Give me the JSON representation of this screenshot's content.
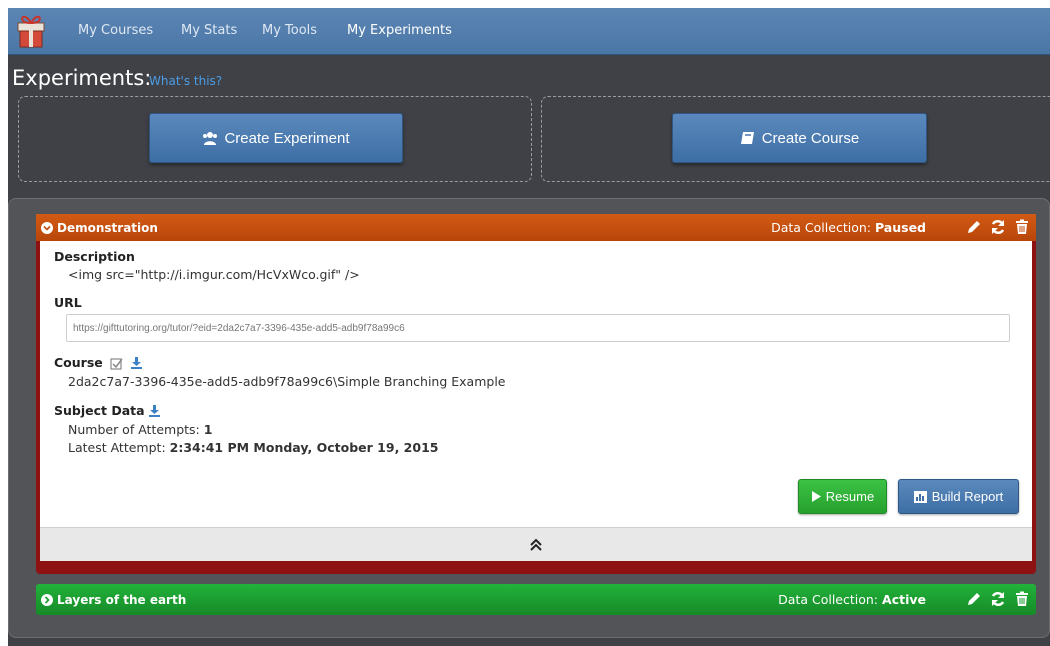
{
  "nav": {
    "items": [
      {
        "label": "My Courses"
      },
      {
        "label": "My Stats"
      },
      {
        "label": "My Tools"
      },
      {
        "label": "My Experiments"
      }
    ]
  },
  "page": {
    "title": "Experiments:",
    "help_link": "What's this?"
  },
  "actions": {
    "create_experiment": "Create Experiment",
    "create_course": "Create Course"
  },
  "experiments": [
    {
      "title": "Demonstration",
      "status_label": "Data Collection:",
      "status_value": "Paused",
      "header_color": "#c34d0c",
      "description_label": "Description",
      "description": "<img src=\"http://i.imgur.com/HcVxWco.gif\" />",
      "url_label": "URL",
      "url": "https://gifttutoring.org/tutor/?eid=2da2c7a7-3396-435e-add5-adb9f78a99c6",
      "course_label": "Course",
      "course": "2da2c7a7-3396-435e-add5-adb9f78a99c6\\Simple Branching Example",
      "subject_label": "Subject Data",
      "attempts_label": "Number of Attempts:",
      "attempts": "1",
      "latest_label": "Latest Attempt:",
      "latest": "2:34:41 PM Monday, October 19, 2015",
      "resume_label": "Resume",
      "report_label": "Build Report"
    },
    {
      "title": "Layers of the earth",
      "status_label": "Data Collection:",
      "status_value": "Active",
      "header_color": "#1a9a2e"
    }
  ],
  "colors": {
    "navbar": "#4f7aab",
    "background": "#3f4146",
    "paused": "#c34d0c",
    "active": "#1a9a2e",
    "resume_button": "#2fab37",
    "report_button": "#3d6ea4"
  },
  "icons": [
    "gift-icon",
    "users-icon",
    "book-icon",
    "chevron-circle-down-icon",
    "chevron-circle-right-icon",
    "pencil-icon",
    "refresh-icon",
    "trash-icon",
    "check-square-icon",
    "download-icon",
    "play-icon",
    "bar-chart-icon",
    "double-chevron-up-icon"
  ]
}
